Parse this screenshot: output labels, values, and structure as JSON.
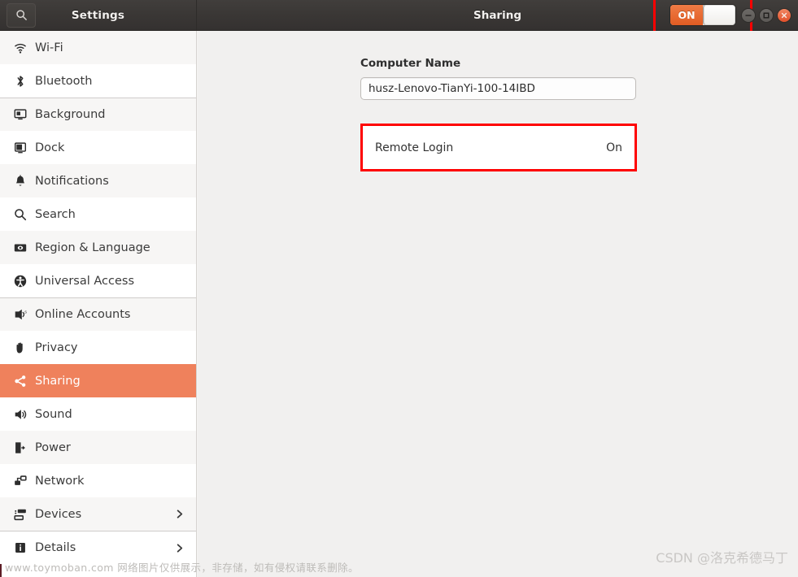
{
  "window": {
    "app_title": "Settings",
    "page_title": "Sharing",
    "search_icon": "search-icon",
    "toggle": {
      "label": "ON",
      "state": "on"
    },
    "controls": [
      {
        "name": "minimize",
        "glyph": "–"
      },
      {
        "name": "maximize",
        "glyph": "□"
      },
      {
        "name": "close",
        "glyph": "×"
      }
    ]
  },
  "sidebar": {
    "items": [
      {
        "label": "Wi-Fi",
        "icon": "wifi-icon",
        "active": false,
        "group_start": false,
        "chevron": false
      },
      {
        "label": "Bluetooth",
        "icon": "bluetooth-icon",
        "active": false,
        "group_start": false,
        "chevron": false
      },
      {
        "label": "Background",
        "icon": "background-icon",
        "active": false,
        "group_start": true,
        "chevron": false
      },
      {
        "label": "Dock",
        "icon": "dock-icon",
        "active": false,
        "group_start": false,
        "chevron": false
      },
      {
        "label": "Notifications",
        "icon": "bell-icon",
        "active": false,
        "group_start": false,
        "chevron": false
      },
      {
        "label": "Search",
        "icon": "search-icon",
        "active": false,
        "group_start": false,
        "chevron": false
      },
      {
        "label": "Region & Language",
        "icon": "region-language-icon",
        "active": false,
        "group_start": false,
        "chevron": false
      },
      {
        "label": "Universal Access",
        "icon": "accessibility-icon",
        "active": false,
        "group_start": false,
        "chevron": false
      },
      {
        "label": "Online Accounts",
        "icon": "online-accounts-icon",
        "active": false,
        "group_start": true,
        "chevron": false
      },
      {
        "label": "Privacy",
        "icon": "hand-icon",
        "active": false,
        "group_start": false,
        "chevron": false
      },
      {
        "label": "Sharing",
        "icon": "share-icon",
        "active": true,
        "group_start": false,
        "chevron": false
      },
      {
        "label": "Sound",
        "icon": "speaker-icon",
        "active": false,
        "group_start": false,
        "chevron": false
      },
      {
        "label": "Power",
        "icon": "power-icon",
        "active": false,
        "group_start": false,
        "chevron": false
      },
      {
        "label": "Network",
        "icon": "network-icon",
        "active": false,
        "group_start": false,
        "chevron": false
      },
      {
        "label": "Devices",
        "icon": "devices-icon",
        "active": false,
        "group_start": false,
        "chevron": true
      },
      {
        "label": "Details",
        "icon": "info-icon",
        "active": false,
        "group_start": true,
        "chevron": true
      }
    ]
  },
  "main": {
    "computer_name_label": "Computer Name",
    "computer_name_value": "husz-Lenovo-TianYi-100-14IBD",
    "computer_name_placeholder": "Computer Name",
    "remote_login_label": "Remote Login",
    "remote_login_value": "On"
  },
  "watermarks": {
    "bottom": "www.toymoban.com 网络图片仅供展示，非存储，如有侵权请联系删除。",
    "csdn": "CSDN @洛克希德马丁"
  },
  "colors": {
    "accent": "#ef815c",
    "titlebar": "#3a3735",
    "toggle_on": "#e15c23",
    "highlight_box": "#fe0000"
  }
}
